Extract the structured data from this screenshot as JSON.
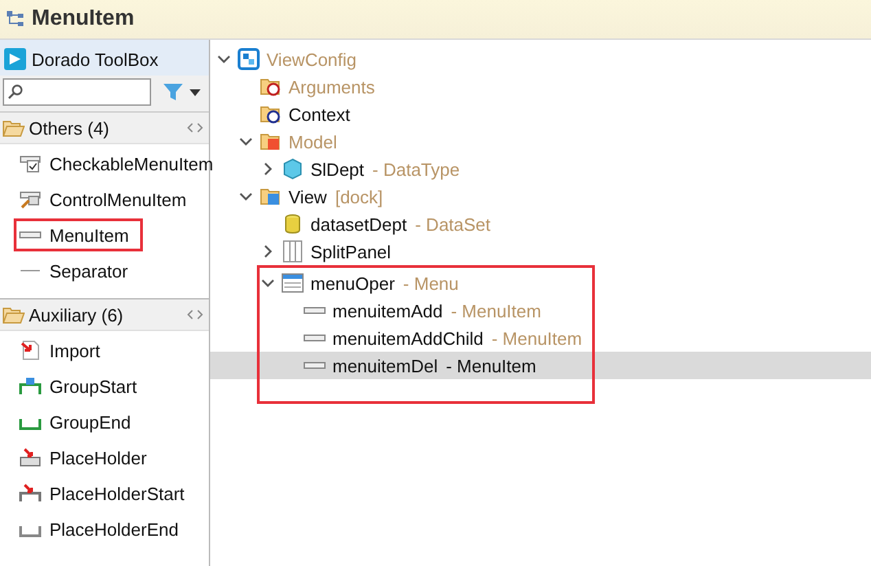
{
  "title": "MenuItem",
  "toolbox": {
    "title": "Dorado ToolBox",
    "groups": [
      {
        "label": "Others (4)",
        "expanded": true,
        "items": [
          {
            "label": "CheckableMenuItem",
            "kind": "checkable",
            "highlighted": false
          },
          {
            "label": "ControlMenuItem",
            "kind": "control",
            "highlighted": false
          },
          {
            "label": "MenuItem",
            "kind": "menu-item",
            "highlighted": true
          },
          {
            "label": "Separator",
            "kind": "separator",
            "highlighted": false
          }
        ]
      },
      {
        "label": "Auxiliary (6)",
        "expanded": true,
        "items": [
          {
            "label": "Import",
            "kind": "import",
            "highlighted": false
          },
          {
            "label": "GroupStart",
            "kind": "group-start",
            "highlighted": false
          },
          {
            "label": "GroupEnd",
            "kind": "group-end",
            "highlighted": false
          },
          {
            "label": "PlaceHolder",
            "kind": "placeholder",
            "highlighted": false
          },
          {
            "label": "PlaceHolderStart",
            "kind": "placeholder-start",
            "highlighted": false
          },
          {
            "label": "PlaceHolderEnd",
            "kind": "placeholder-end",
            "highlighted": false
          }
        ]
      }
    ]
  },
  "tree": [
    {
      "name": "ViewConfig",
      "kind": "view-config",
      "dimmed": true,
      "expanded": true,
      "selected": false,
      "highlighted": false,
      "children": [
        {
          "name": "Arguments",
          "kind": "folder-arguments",
          "dimmed": true,
          "selected": false,
          "highlighted": false
        },
        {
          "name": "Context",
          "kind": "folder-context",
          "dimmed": false,
          "selected": false,
          "highlighted": false
        },
        {
          "name": "Model",
          "kind": "folder-model",
          "dimmed": true,
          "expanded": true,
          "selected": false,
          "highlighted": false,
          "children": [
            {
              "name": "SlDept",
              "suffix": "- DataType",
              "kind": "data-type",
              "dimmed": false,
              "expanded": false,
              "selected": false,
              "highlighted": false
            }
          ]
        },
        {
          "name": "View",
          "suffix": "[dock]",
          "kind": "folder-view",
          "dimmed": false,
          "expanded": true,
          "selected": false,
          "highlighted": false,
          "children": [
            {
              "name": "datasetDept",
              "suffix": "- DataSet",
              "kind": "dataset",
              "dimmed": false,
              "selected": false,
              "highlighted": false
            },
            {
              "name": "SplitPanel",
              "kind": "split-panel",
              "dimmed": false,
              "expanded": false,
              "selected": false,
              "highlighted": false
            },
            {
              "name": "menuOper",
              "suffix": "- Menu",
              "kind": "menu",
              "dimmed": false,
              "expanded": true,
              "selected": false,
              "highlighted": true,
              "children": [
                {
                  "name": "menuitemAdd",
                  "suffix": "- MenuItem",
                  "kind": "menu-item",
                  "dimmed": false,
                  "selected": false,
                  "highlighted": false
                },
                {
                  "name": "menuitemAddChild",
                  "suffix": "- MenuItem",
                  "kind": "menu-item",
                  "dimmed": false,
                  "selected": false,
                  "highlighted": false
                },
                {
                  "name": "menuitemDel",
                  "suffix": "- MenuItem",
                  "kind": "menu-item",
                  "dimmed": false,
                  "selected": true,
                  "highlighted": false
                }
              ]
            }
          ]
        }
      ]
    }
  ]
}
